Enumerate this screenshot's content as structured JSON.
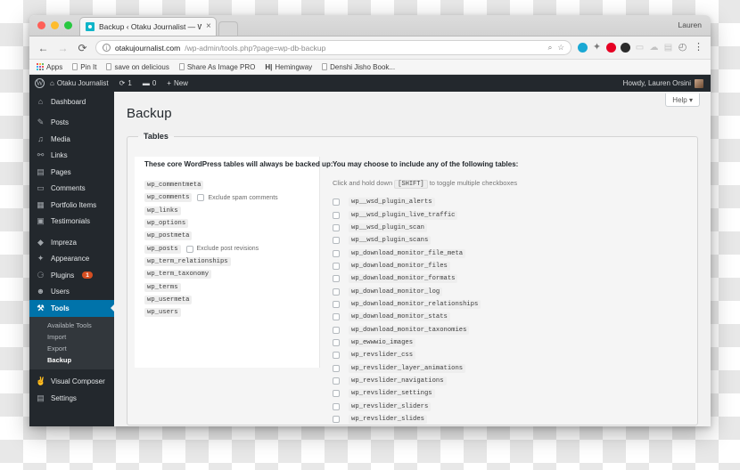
{
  "os": {
    "user_menu_label": "Lauren"
  },
  "browser": {
    "tab": {
      "title": "Backup ‹ Otaku Journalist — W",
      "close_label": "×"
    },
    "nav": {
      "back": "←",
      "forward": "→",
      "reload": "⟳"
    },
    "url": {
      "host": "otakujournalist.com",
      "path": "/wp-admin/tools.php?page=wp-db-backup",
      "security_label": "ⓘ"
    },
    "omnibox_actions": {
      "search": "⌕",
      "bookmark": "☆",
      "menu": "⋮"
    },
    "extensions": [
      "pocket-icon",
      "sparkle-icon",
      "pinterest-icon",
      "ghostery-icon",
      "speech-bubble-icon",
      "cloud-icon",
      "note-icon",
      "clock-icon"
    ],
    "bookmarks": [
      {
        "label": "Apps",
        "icon": "apps-grid-icon"
      },
      {
        "label": "Pin It",
        "icon": "page-icon"
      },
      {
        "label": "save on delicious",
        "icon": "page-icon"
      },
      {
        "label": "Share As Image PRO",
        "icon": "page-icon"
      },
      {
        "label": "Hemingway",
        "icon": "h-icon"
      },
      {
        "label": "Denshi Jisho Book...",
        "icon": "page-icon"
      }
    ]
  },
  "adminbar": {
    "logo": "wordpress-icon",
    "site_name": "Otaku Journalist",
    "updates_count": "1",
    "comments_count": "0",
    "new_label": "New",
    "howdy": "Howdy, Lauren Orsini"
  },
  "sidebar": {
    "items": [
      {
        "label": "Dashboard",
        "icon": "dashboard-icon",
        "glyph": "⌂",
        "current": false
      },
      {
        "label": "Posts",
        "icon": "pin-icon",
        "glyph": "✎",
        "current": false
      },
      {
        "label": "Media",
        "icon": "media-icon",
        "glyph": "♫",
        "current": false
      },
      {
        "label": "Links",
        "icon": "link-icon",
        "glyph": "⚯",
        "current": false
      },
      {
        "label": "Pages",
        "icon": "pages-icon",
        "glyph": "▤",
        "current": false
      },
      {
        "label": "Comments",
        "icon": "comments-icon",
        "glyph": "▭",
        "current": false
      },
      {
        "label": "Portfolio Items",
        "icon": "portfolio-icon",
        "glyph": "▦",
        "current": false
      },
      {
        "label": "Testimonials",
        "icon": "testimonials-icon",
        "glyph": "▣",
        "current": false
      },
      {
        "label": "Impreza",
        "icon": "gem-icon",
        "glyph": "◆",
        "current": false
      },
      {
        "label": "Appearance",
        "icon": "brush-icon",
        "glyph": "✦",
        "current": false
      },
      {
        "label": "Plugins",
        "icon": "plugins-icon",
        "glyph": "⚆",
        "current": false,
        "badge": "1"
      },
      {
        "label": "Users",
        "icon": "users-icon",
        "glyph": "☻",
        "current": false
      },
      {
        "label": "Tools",
        "icon": "wrench-icon",
        "glyph": "🔧",
        "current": true
      },
      {
        "label": "Visual Composer",
        "icon": "visual-composer-icon",
        "glyph": "✌",
        "current": false
      },
      {
        "label": "Settings",
        "icon": "settings-icon",
        "glyph": "▤",
        "current": false
      }
    ],
    "submenu": [
      {
        "label": "Available Tools",
        "current": false
      },
      {
        "label": "Import",
        "current": false
      },
      {
        "label": "Export",
        "current": false
      },
      {
        "label": "Backup",
        "current": true
      }
    ]
  },
  "page": {
    "title": "Backup",
    "help_tab": "Help",
    "fieldset_legend": "Tables",
    "core_heading": "These core WordPress tables will always be backed up:",
    "optional_heading": "You may choose to include any of the following tables:",
    "hint_before": "Click and hold down",
    "hint_key": "[SHIFT]",
    "hint_after": "to toggle multiple checkboxes",
    "core_tables": [
      {
        "name": "wp_commentmeta"
      },
      {
        "name": "wp_comments",
        "option": "Exclude spam comments",
        "checked": false
      },
      {
        "name": "wp_links"
      },
      {
        "name": "wp_options"
      },
      {
        "name": "wp_postmeta"
      },
      {
        "name": "wp_posts",
        "option": "Exclude post revisions",
        "checked": false
      },
      {
        "name": "wp_term_relationships"
      },
      {
        "name": "wp_term_taxonomy"
      },
      {
        "name": "wp_terms"
      },
      {
        "name": "wp_usermeta"
      },
      {
        "name": "wp_users"
      }
    ],
    "optional_tables": [
      {
        "name": "wp__wsd_plugin_alerts",
        "checked": false
      },
      {
        "name": "wp__wsd_plugin_live_traffic",
        "checked": false
      },
      {
        "name": "wp__wsd_plugin_scan",
        "checked": false
      },
      {
        "name": "wp__wsd_plugin_scans",
        "checked": false
      },
      {
        "name": "wp_download_monitor_file_meta",
        "checked": false
      },
      {
        "name": "wp_download_monitor_files",
        "checked": false
      },
      {
        "name": "wp_download_monitor_formats",
        "checked": false
      },
      {
        "name": "wp_download_monitor_log",
        "checked": false
      },
      {
        "name": "wp_download_monitor_relationships",
        "checked": false
      },
      {
        "name": "wp_download_monitor_stats",
        "checked": false
      },
      {
        "name": "wp_download_monitor_taxonomies",
        "checked": false
      },
      {
        "name": "wp_ewwwio_images",
        "checked": false
      },
      {
        "name": "wp_revslider_css",
        "checked": false
      },
      {
        "name": "wp_revslider_layer_animations",
        "checked": false
      },
      {
        "name": "wp_revslider_navigations",
        "checked": false
      },
      {
        "name": "wp_revslider_settings",
        "checked": false
      },
      {
        "name": "wp_revslider_sliders",
        "checked": false
      },
      {
        "name": "wp_revslider_slides",
        "checked": false
      }
    ]
  },
  "colors": {
    "wp_admin_bg": "#23282d",
    "wp_submenu_bg": "#32373c",
    "wp_current_blue": "#0073aa",
    "plugin_badge": "#d54e21",
    "impreza_gem": "#1fd1b0",
    "pinterest": "#e60023"
  }
}
